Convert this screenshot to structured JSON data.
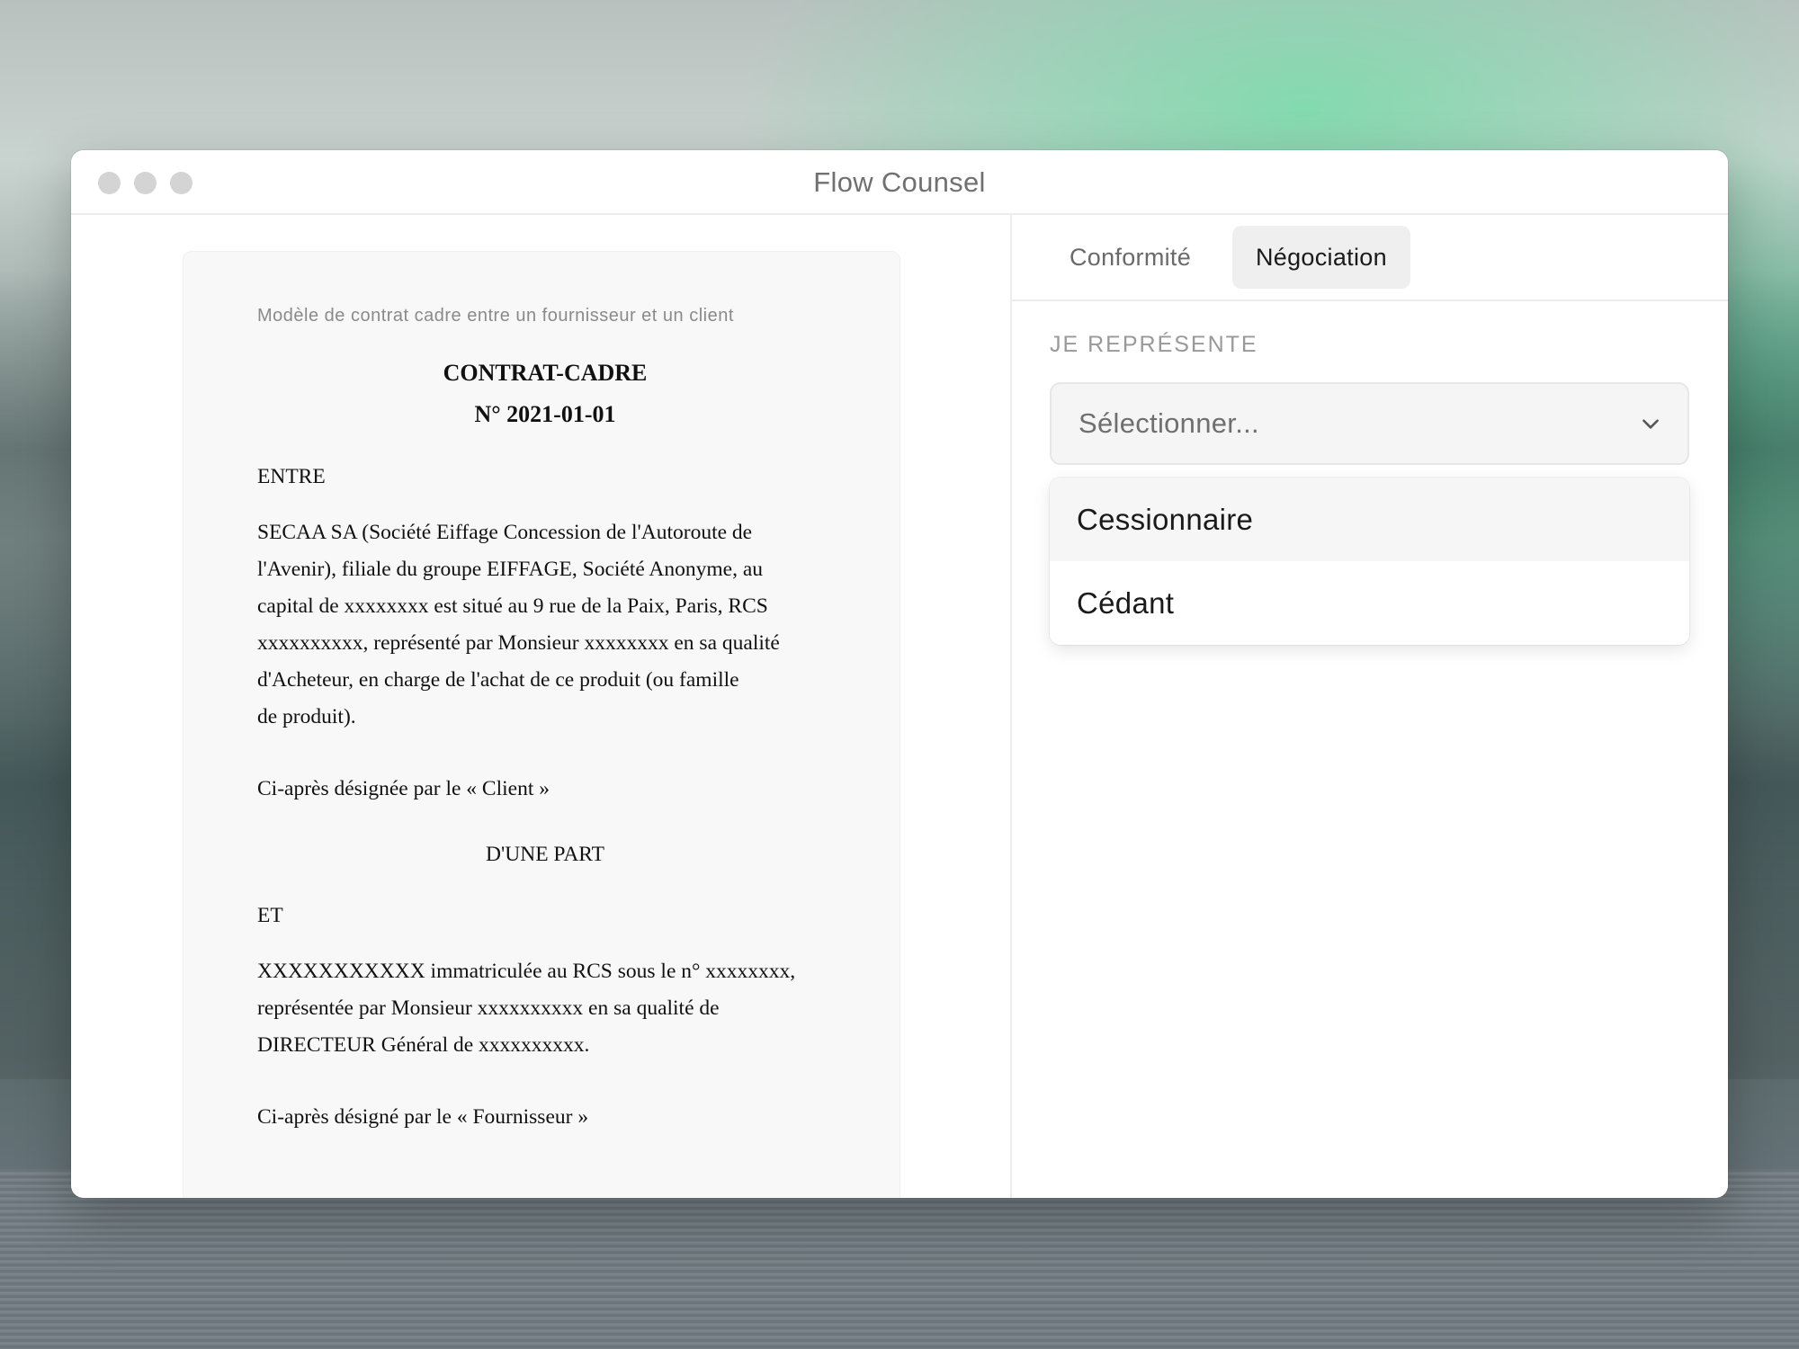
{
  "window": {
    "title": "Flow Counsel"
  },
  "document": {
    "caption": "Modèle de contrat cadre entre un fournisseur et un client",
    "title_line1": "CONTRAT-CADRE",
    "title_line2": "N° 2021-01-01",
    "entre": "ENTRE",
    "party1_lines": [
      "SECAA SA (Société Eiffage Concession de l'Autoroute de",
      "l'Avenir), filiale du groupe EIFFAGE, Société Anonyme, au",
      "capital de xxxxxxxx est situé au 9 rue de la Paix, Paris, RCS",
      "xxxxxxxxxx, représenté par Monsieur xxxxxxxx en sa qualité",
      "d'Acheteur, en charge de l'achat de ce produit (ou famille",
      "de produit)."
    ],
    "client_designation": "Ci-après désignée par le « Client »",
    "dune_part": "D'UNE PART",
    "et": "ET",
    "party2_lines": [
      "XXXXXXXXXXX immatriculée au RCS sous le n° xxxxxxxx,",
      "représentée par Monsieur xxxxxxxxxx en sa qualité de",
      "DIRECTEUR Général de xxxxxxxxxx."
    ],
    "supplier_designation": "Ci-après désigné par le « Fournisseur »"
  },
  "panel": {
    "tabs": [
      {
        "label": "Conformité",
        "active": false
      },
      {
        "label": "Négociation",
        "active": true
      }
    ],
    "field_label": "JE REPRÉSENTE",
    "select_placeholder": "Sélectionner...",
    "options": [
      "Cessionnaire",
      "Cédant"
    ],
    "highlighted_option": "Cessionnaire"
  },
  "colors": {
    "window_bg": "#ffffff",
    "doc_bg": "#f8f8f8",
    "active_tab_bg": "#efefef",
    "accent_green": "#5fcf9a"
  }
}
